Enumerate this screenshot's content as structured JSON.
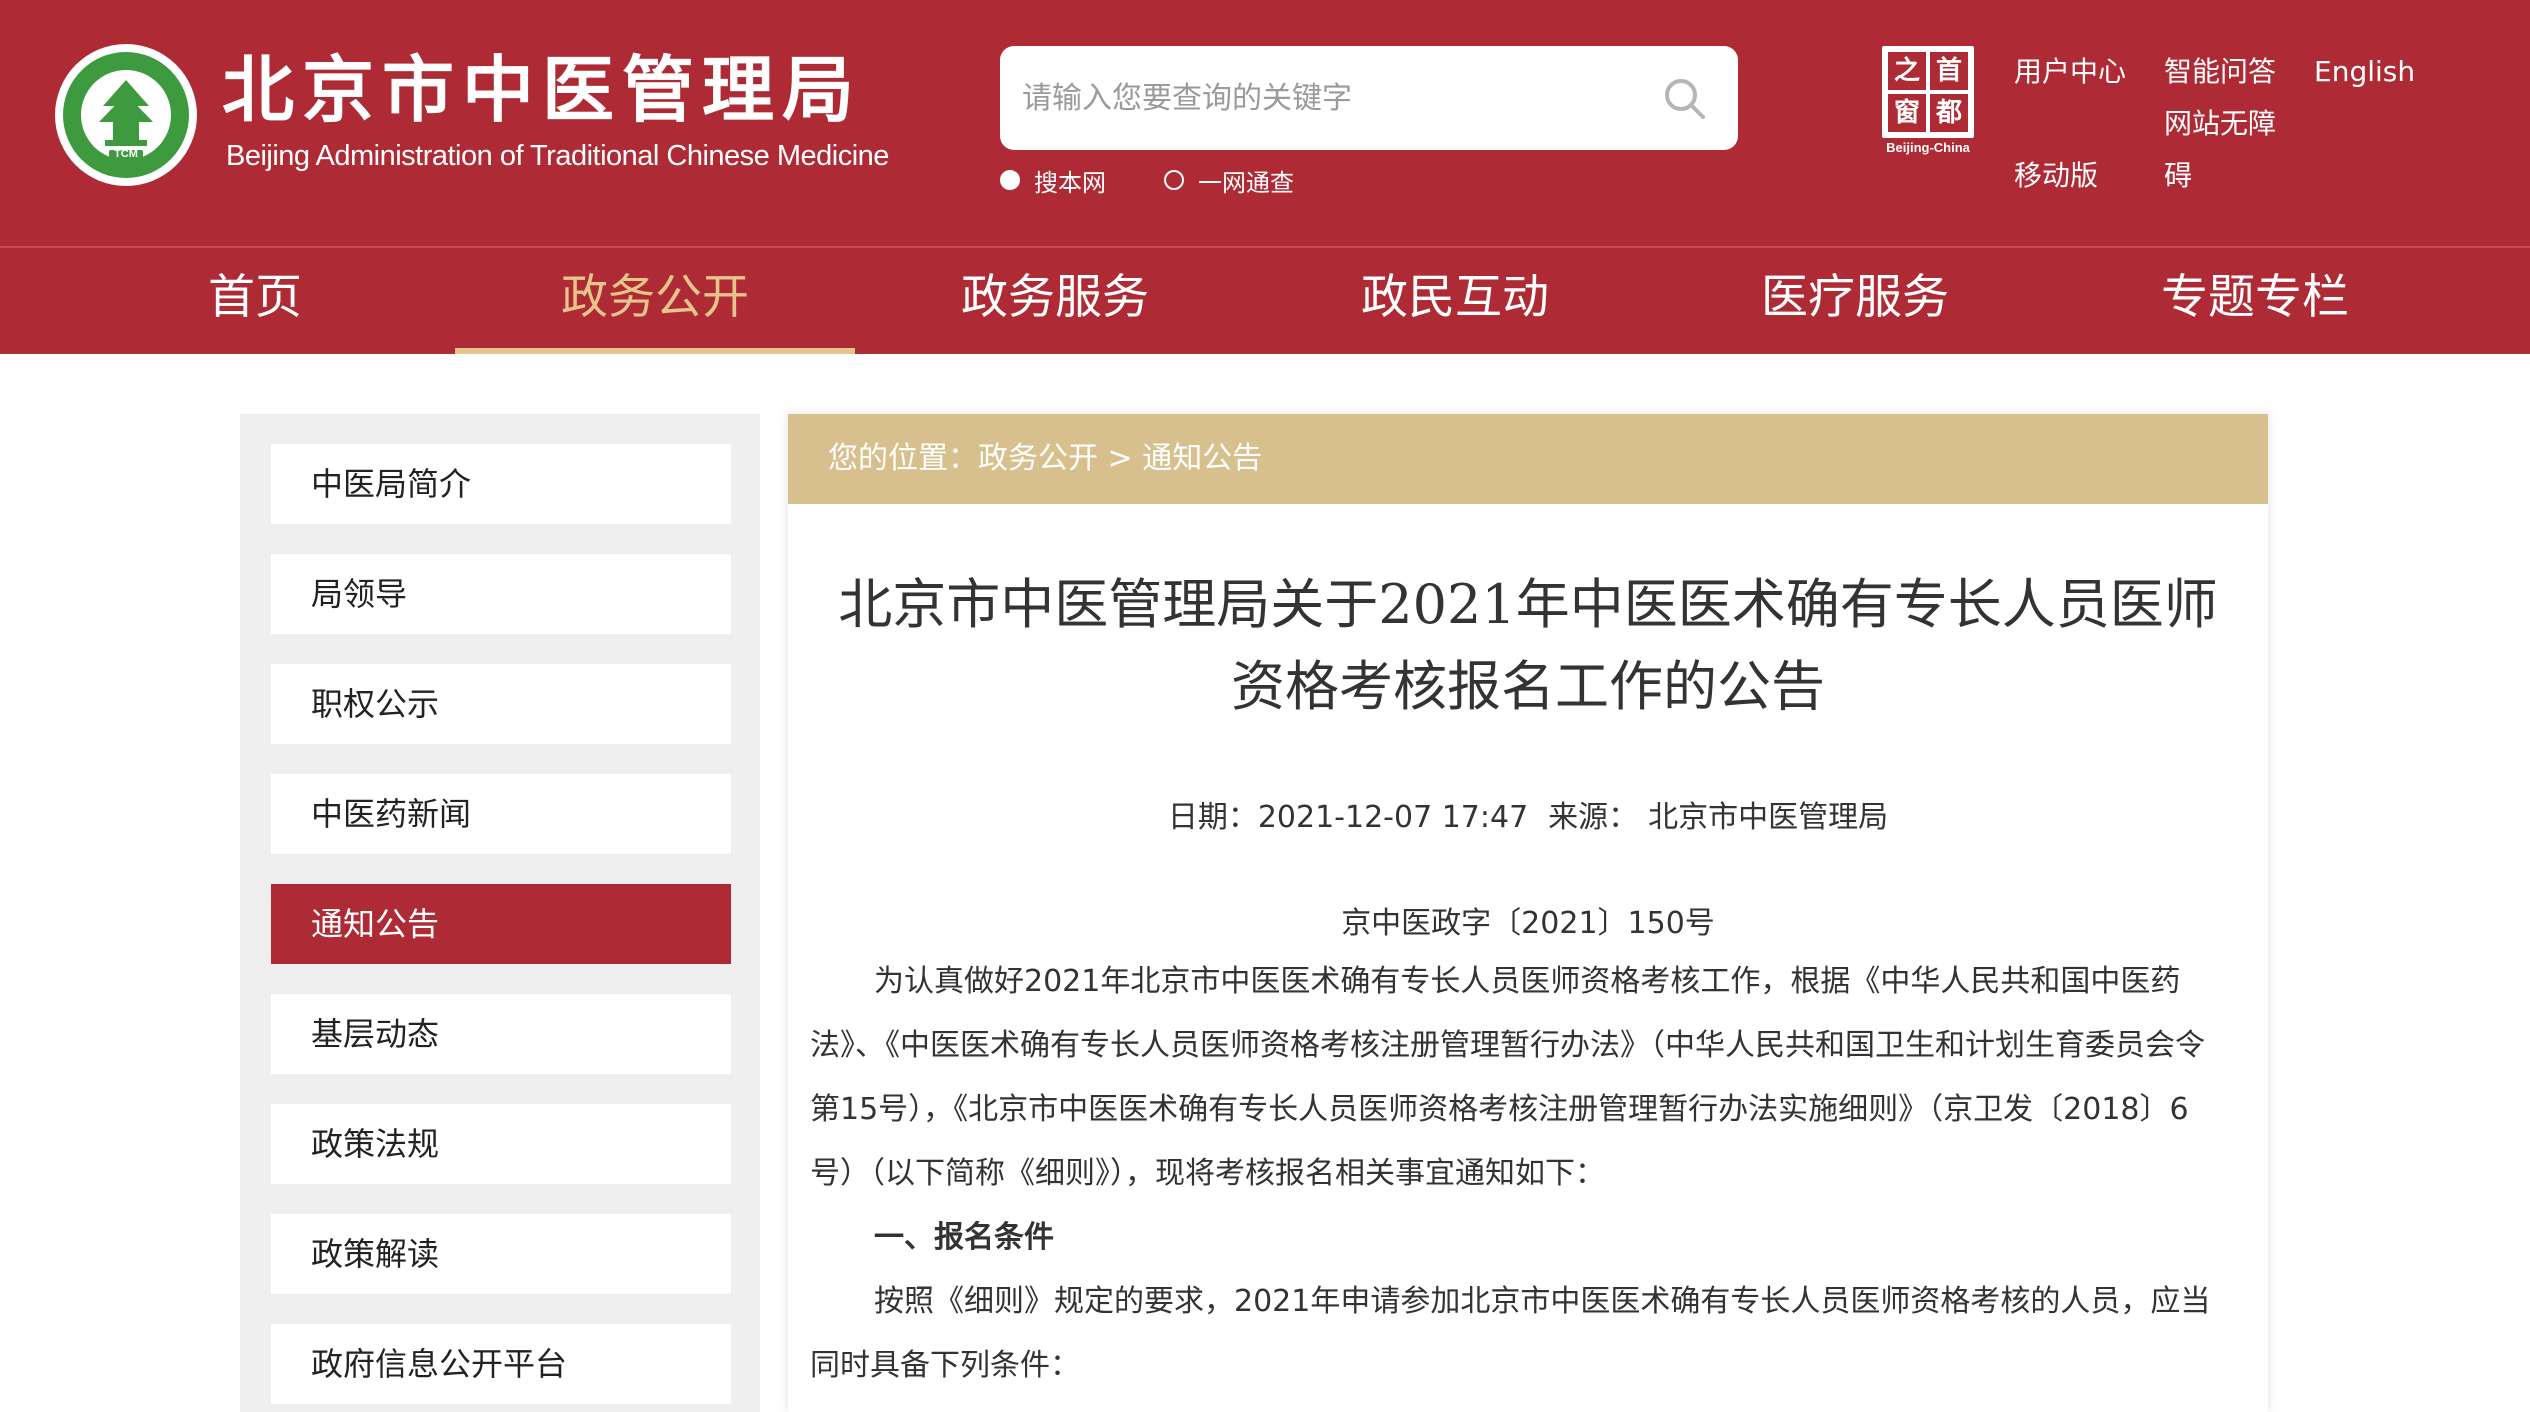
{
  "header": {
    "site_title": "北京市中医管理局",
    "site_subtitle": "Beijing Administration of Traditional Chinese Medicine",
    "logo_text": "TCM",
    "search": {
      "placeholder": "请输入您要查询的关键字",
      "options": [
        {
          "label": "搜本网",
          "checked": true
        },
        {
          "label": "一网通查",
          "checked": false
        }
      ]
    },
    "capital_badge": {
      "chars": [
        "之",
        "首",
        "窗",
        "都"
      ],
      "caption": "Beijing-China"
    },
    "links": {
      "user_center": "用户中心",
      "faq": "智能问答",
      "english": "English",
      "accessibility_line1": "网站无障",
      "accessibility_line2": "碍",
      "mobile": "移动版"
    }
  },
  "nav": {
    "items": [
      "首页",
      "政务公开",
      "政务服务",
      "政民互动",
      "医疗服务",
      "专题专栏"
    ],
    "active_index": 1
  },
  "sidebar": {
    "items": [
      "中医局简介",
      "局领导",
      "职权公示",
      "中医药新闻",
      "通知公告",
      "基层动态",
      "政策法规",
      "政策解读",
      "政府信息公开平台"
    ],
    "active_index": 4
  },
  "breadcrumb": {
    "prefix": "您的位置：",
    "level1": "政务公开",
    "separator": " > ",
    "level2": "通知公告"
  },
  "article": {
    "title_line1": "北京市中医管理局关于2021年中医医术确有专长人员医师",
    "title_line2": "资格考核报名工作的公告",
    "date_label": "日期：",
    "date": "2021-12-07 17:47",
    "source_label": "来源：",
    "source": "北京市中医管理局",
    "doc_number": "京中医政字〔2021〕150号",
    "para1": "为认真做好2021年北京市中医医术确有专长人员医师资格考核工作，根据《中华人民共和国中医药法》、《中医医术确有专长人员医师资格考核注册管理暂行办法》（中华人民共和国卫生和计划生育委员会令第15号），《北京市中医医术确有专长人员医师资格考核注册管理暂行办法实施细则》（京卫发〔2018〕6号）（以下简称《细则》），现将考核报名相关事宜通知如下：",
    "heading1": "一、报名条件",
    "para2": "按照《细则》规定的要求，2021年申请参加北京市中医医术确有专长人员医师资格考核的人员，应当同时具备下列条件："
  },
  "colors": {
    "brand_red": "#ae2b35",
    "accent_gold": "#e6c58c",
    "breadcrumb_bg": "#d8c08e",
    "logo_green": "#3d9a3e"
  }
}
